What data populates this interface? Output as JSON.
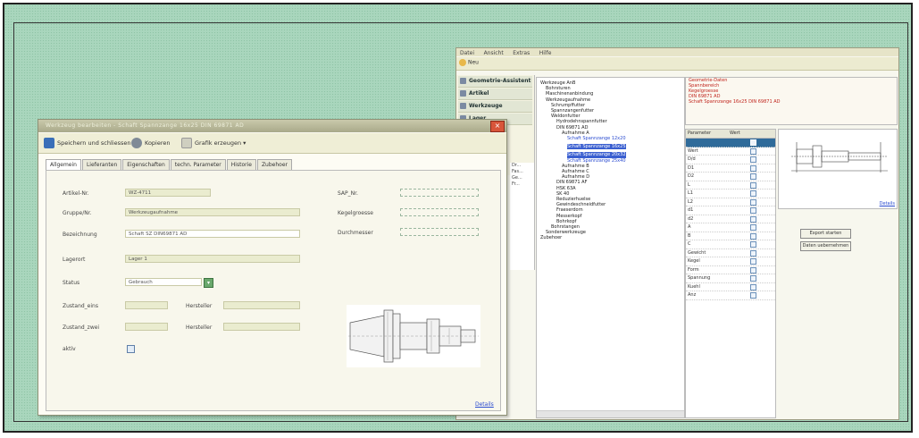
{
  "back_window": {
    "menu": [
      "Datei",
      "Ansicht",
      "Extras",
      "Hilfe"
    ],
    "toolbar_new": "Neu",
    "nav": [
      "Geometrie-Assistent",
      "Artikel",
      "Werkzeuge",
      "Lager"
    ],
    "side_list": [
      "Dr...",
      "Fas...",
      "Ge...",
      "Fr..."
    ],
    "tree": [
      {
        "t": "Werkzeuge AnB",
        "lvl": 0
      },
      {
        "t": "Bohrsturen",
        "lvl": 1
      },
      {
        "t": "Maschinenanbindung",
        "lvl": 1
      },
      {
        "t": "Werkzeugaufnahme",
        "lvl": 1
      },
      {
        "t": "Schrumpffutter",
        "lvl": 2
      },
      {
        "t": "Spannzangenfutter",
        "lvl": 2
      },
      {
        "t": "Weldonfutter",
        "lvl": 2
      },
      {
        "t": "Hydrodehnspannfutter",
        "lvl": 3
      },
      {
        "t": "DIN 69871 AD",
        "lvl": 3
      },
      {
        "t": "Aufnahme A",
        "lvl": 4
      },
      {
        "t": "Schaft Spannzange 12x20",
        "lvl": 5,
        "style": "blue"
      },
      {
        "t": "Schaft Spannzange 16x25",
        "lvl": 5,
        "style": "sel"
      },
      {
        "t": "Schaft Spannzange 20x32",
        "lvl": 5,
        "style": "sel"
      },
      {
        "t": "Schaft Spannzange 25x40",
        "lvl": 5,
        "style": "blue"
      },
      {
        "t": "Aufnahme B",
        "lvl": 4
      },
      {
        "t": "Aufnahme C",
        "lvl": 4
      },
      {
        "t": "Aufnahme D",
        "lvl": 4
      },
      {
        "t": "DIN 69871 AF",
        "lvl": 3
      },
      {
        "t": "HSK 63A",
        "lvl": 3
      },
      {
        "t": "SK 40",
        "lvl": 3
      },
      {
        "t": "Reduzierhuelse",
        "lvl": 3
      },
      {
        "t": "Gewindeschneidfutter",
        "lvl": 3
      },
      {
        "t": "Fraeserdorn",
        "lvl": 3
      },
      {
        "t": "Messerkopf",
        "lvl": 3
      },
      {
        "t": "Bohrkopf",
        "lvl": 3
      },
      {
        "t": "Bohrstangen",
        "lvl": 2
      },
      {
        "t": "Sonderwerkzeuge",
        "lvl": 1
      },
      {
        "t": "Zubehoer",
        "lvl": 0
      }
    ],
    "red_info": [
      "Geometrie-Daten",
      "Spannbereich",
      "Kegelgroesse",
      "DIN 69871 AD",
      "Schaft Spannzange 16x25 DIN 69871 AD"
    ],
    "param_table": {
      "headers": [
        "Parameter",
        "Wert"
      ],
      "rows": [
        "",
        "Wert",
        "D/d",
        "D1",
        "D2",
        "L",
        "L1",
        "L2",
        "d1",
        "d2",
        "A",
        "B",
        "C",
        "Gewicht",
        "Kegel",
        "Form",
        "Spannung",
        "Kuehl",
        "Anz"
      ]
    },
    "thumb_link": "Details",
    "buttons": [
      "Export starten",
      "Daten uebernehmen"
    ]
  },
  "front_window": {
    "title": "Werkzeug bearbeiten - Schaft Spannzange 16x25 DIN 69871 AD",
    "toolbar": {
      "save": "Speichern und schliessen",
      "copy": "Kopieren",
      "gen": "Grafik erzeugen"
    },
    "tabs": [
      "Allgemein",
      "Lieferanten",
      "Eigenschaften",
      "techn. Parameter",
      "Historie",
      "Zubehoer"
    ],
    "fields": {
      "artikel_label": "Artikel-Nr.",
      "artikel_value": "WZ-4711",
      "gruppe_label": "Gruppe/Nr.",
      "gruppe_value": "Werkzeugaufnahme",
      "bezeichnung_label": "Bezeichnung",
      "bezeichnung_value": "Schaft SZ DIN69871 AD",
      "lager_label": "Lagerort",
      "lager_value": "Lager 1",
      "status_label": "Status",
      "status_value": "Gebrauch",
      "zustand1_label": "Zustand_eins",
      "zustand1_value": "",
      "hersteller1_label": "Hersteller",
      "zustand2_label": "Zustand_zwei",
      "hersteller2_label": "Hersteller",
      "aktiv_label": "aktiv",
      "sap_label": "SAP_Nr.",
      "kegel_label": "Kegelgroesse",
      "durch_label": "Durchmesser"
    },
    "link": "Details"
  }
}
